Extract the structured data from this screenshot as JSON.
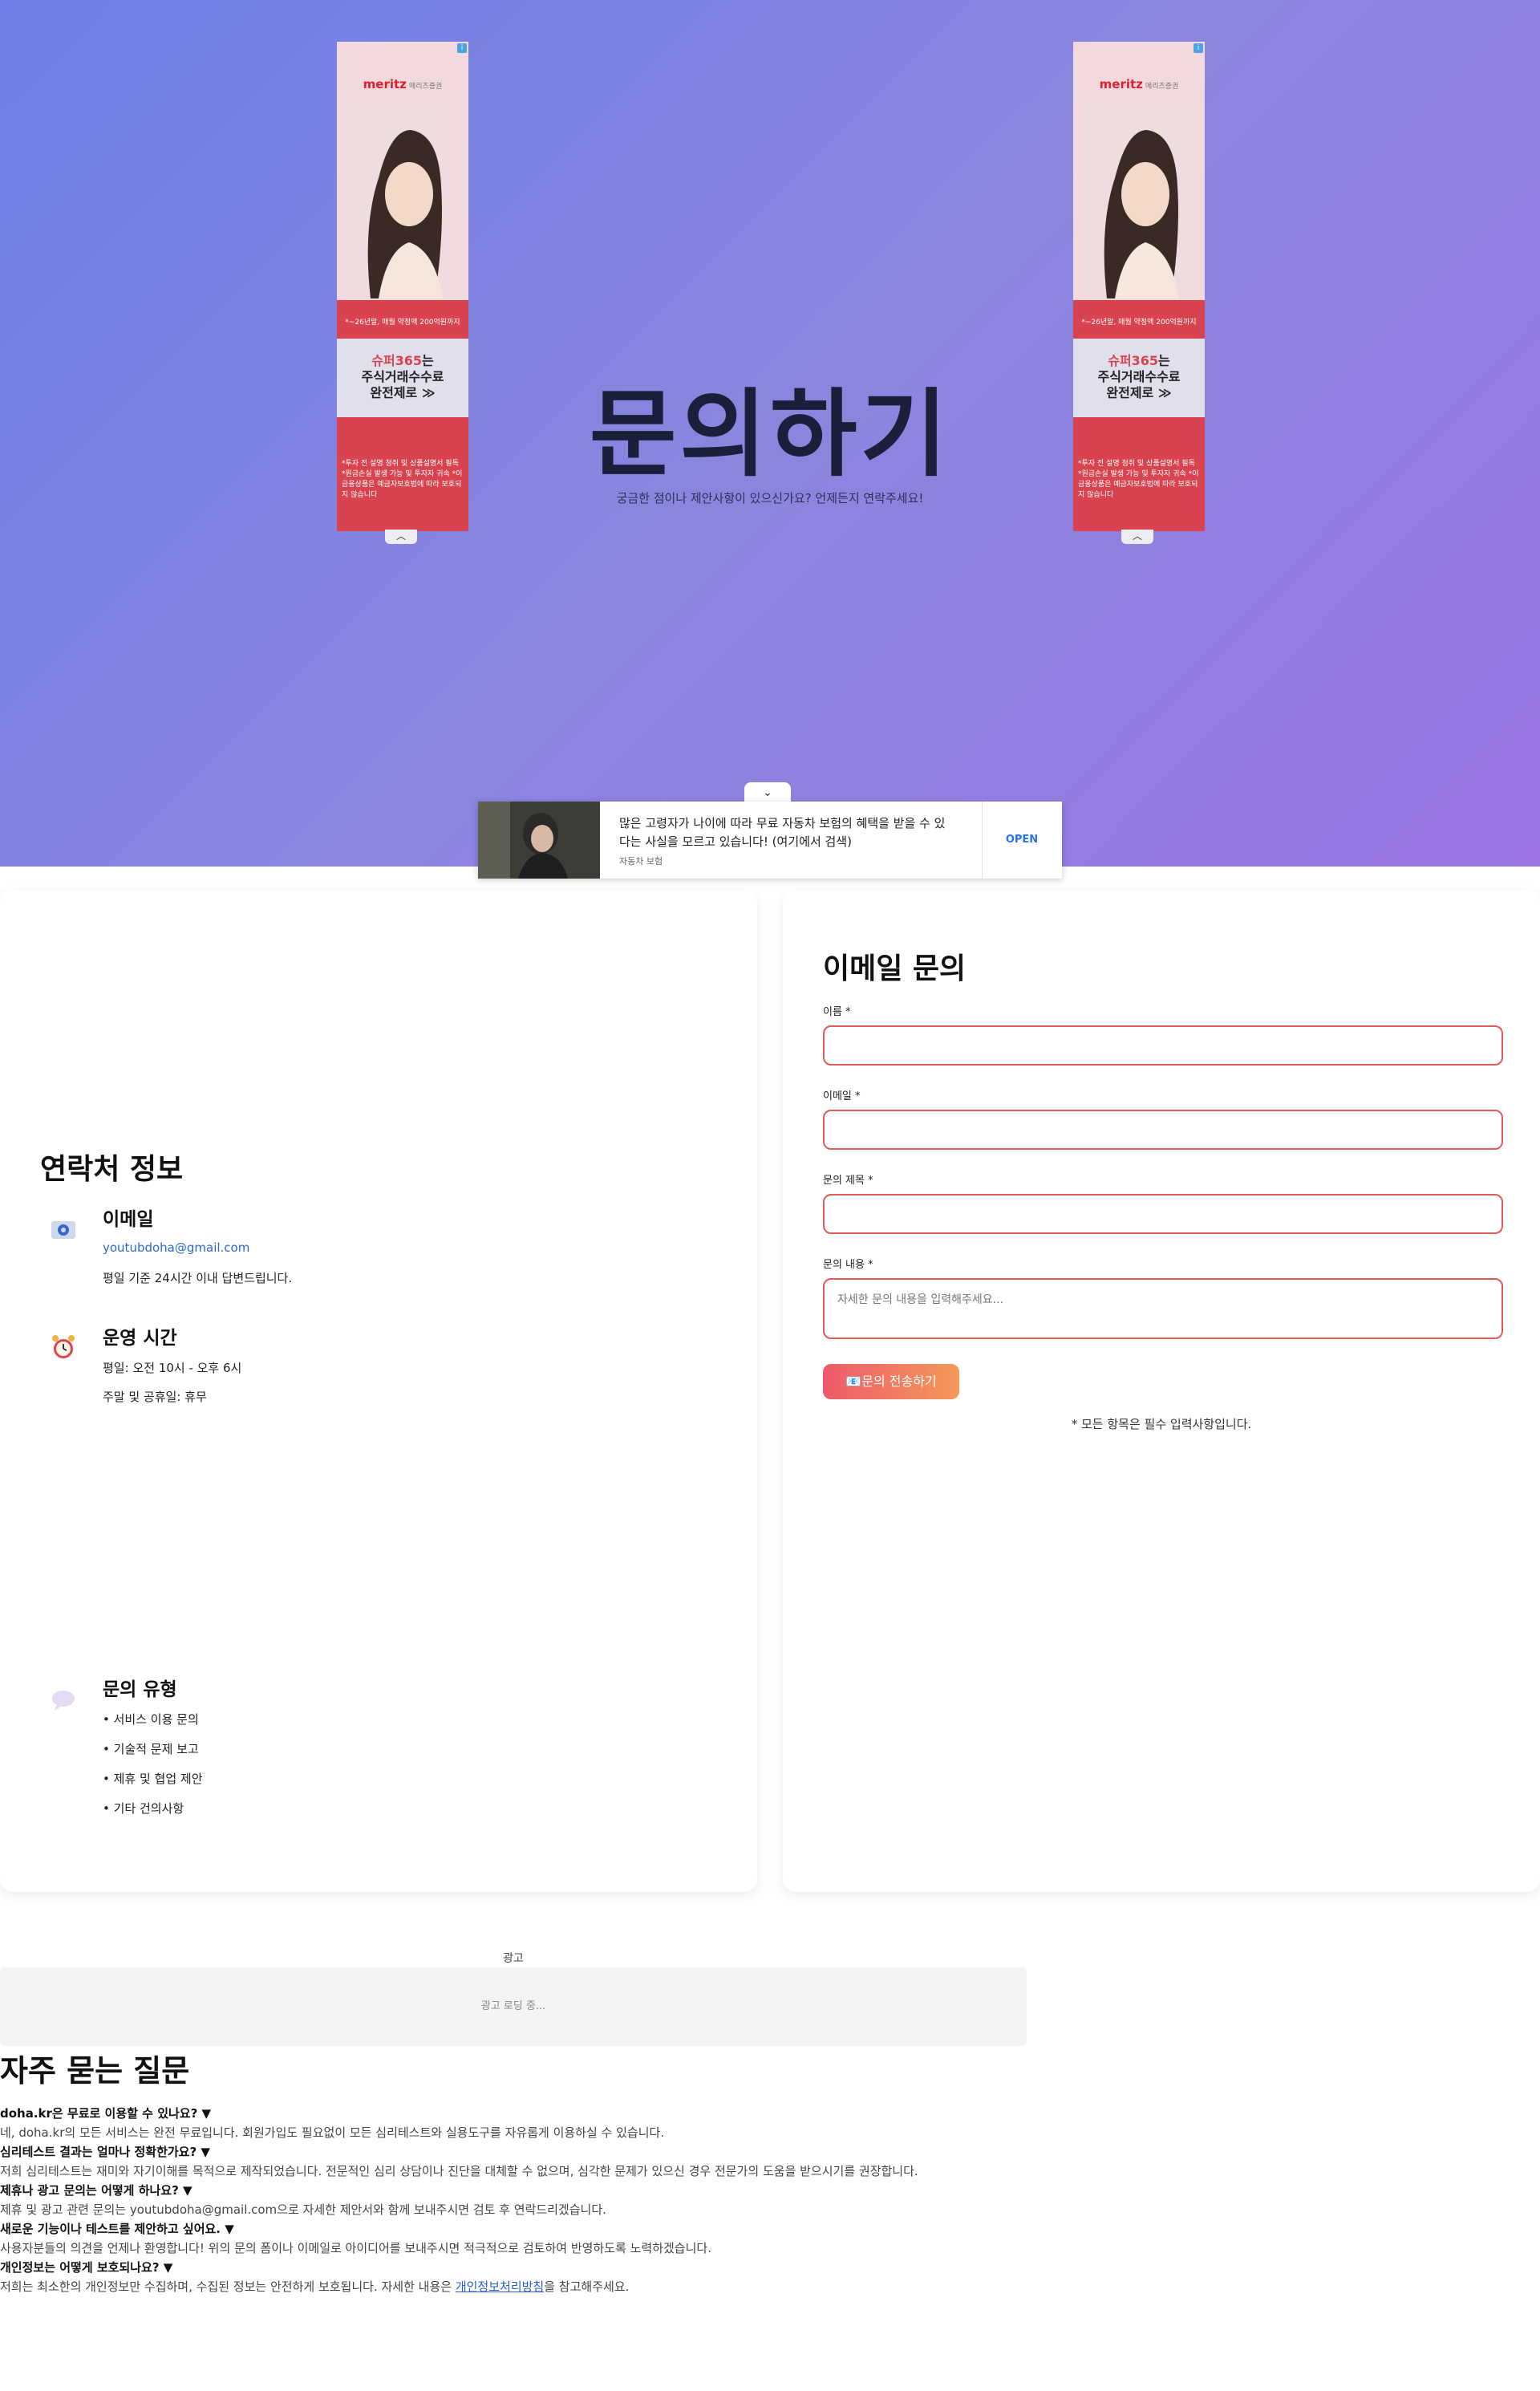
{
  "hero": {
    "title": "문의하기",
    "subtitle": "궁금한 점이나 제안사항이 있으신가요? 언제든지 연락주세요!"
  },
  "side_ad": {
    "brand": "meritz",
    "brand_sub": "메리츠증권",
    "red_note": "*~26년말, 매월 약정액 200억원까지",
    "headline_1": "슈퍼365",
    "headline_1_suffix": "는",
    "headline_2": "주식거래수수료",
    "headline_3": "완전제로 ≫",
    "disclaimer": "*투자 전 설명 청취 및 상품설명서 필독 *원금손실 발생 가능 및 투자자 귀속 *이 금융상품은 예금자보호법에 따라 보호되지 않습니다",
    "info": "i",
    "collapse": "︿"
  },
  "sticky_ad": {
    "toggle": "⌄",
    "text": "많은 고령자가 나이에 따라 무료 자동차 보험의 혜택을 받을 수 있다는 사실을 모르고 있습니다! (여기에서 검색)",
    "source": "자동차 보험",
    "cta": "OPEN"
  },
  "contact": {
    "title": "연락처 정보",
    "email": {
      "icon": "email-icon",
      "title": "이메일",
      "address": "youtubdoha@gmail.com",
      "note": "평일 기준 24시간 이내 답변드립니다."
    },
    "hours": {
      "icon": "alarm-clock-icon",
      "title": "운영 시간",
      "weekday": "평일: 오전 10시 - 오후 6시",
      "weekend": "주말 및 공휴일: 휴무"
    },
    "types": {
      "icon": "speech-bubble-icon",
      "title": "문의 유형",
      "items": [
        "• 서비스 이용 문의",
        "• 기술적 문제 보고",
        "• 제휴 및 협업 제안",
        "• 기타 건의사항"
      ]
    }
  },
  "form": {
    "title": "이메일 문의",
    "name_label": "이름 *",
    "email_label": "이메일 *",
    "subject_label": "문의 제목 *",
    "message_label": "문의 내용 *",
    "message_placeholder": "자세한 문의 내용을 입력해주세요...",
    "submit": "📧문의 전송하기",
    "note": "* 모든 항목은 필수 입력사항입니다."
  },
  "ad_slot": {
    "label": "광고",
    "loading": "광고 로딩 중..."
  },
  "faq": {
    "title": "자주 묻는 질문",
    "items": [
      {
        "q": "doha.kr은 무료로 이용할 수 있나요? ▼",
        "a": "네, doha.kr의 모든 서비스는 완전 무료입니다. 회원가입도 필요없이 모든 심리테스트와 실용도구를 자유롭게 이용하실 수 있습니다."
      },
      {
        "q": "심리테스트 결과는 얼마나 정확한가요? ▼",
        "a": "저희 심리테스트는 재미와 자기이해를 목적으로 제작되었습니다. 전문적인 심리 상담이나 진단을 대체할 수 없으며, 심각한 문제가 있으신 경우 전문가의 도움을 받으시기를 권장합니다."
      },
      {
        "q": "제휴나 광고 문의는 어떻게 하나요? ▼",
        "a": "제휴 및 광고 관련 문의는 youtubdoha@gmail.com으로 자세한 제안서와 함께 보내주시면 검토 후 연락드리겠습니다."
      },
      {
        "q": "새로운 기능이나 테스트를 제안하고 싶어요. ▼",
        "a": "사용자분들의 의견을 언제나 환영합니다! 위의 문의 폼이나 이메일로 아이디어를 보내주시면 적극적으로 검토하여 반영하도록 노력하겠습니다."
      },
      {
        "q": "개인정보는 어떻게 보호되나요? ▼",
        "a_pre": "저희는 최소한의 개인정보만 수집하며, 수집된 정보는 안전하게 보호됩니다. 자세한 내용은 ",
        "a_link": "개인정보처리방침",
        "a_post": "을 참고해주세요."
      }
    ]
  },
  "colors": {
    "hero_start": "#6f7ee6",
    "hero_end": "#9b75e3",
    "input_border": "#e25a5a",
    "button_start": "#ee5a6a",
    "button_end": "#f49a5a",
    "link": "#2a6ad1"
  }
}
